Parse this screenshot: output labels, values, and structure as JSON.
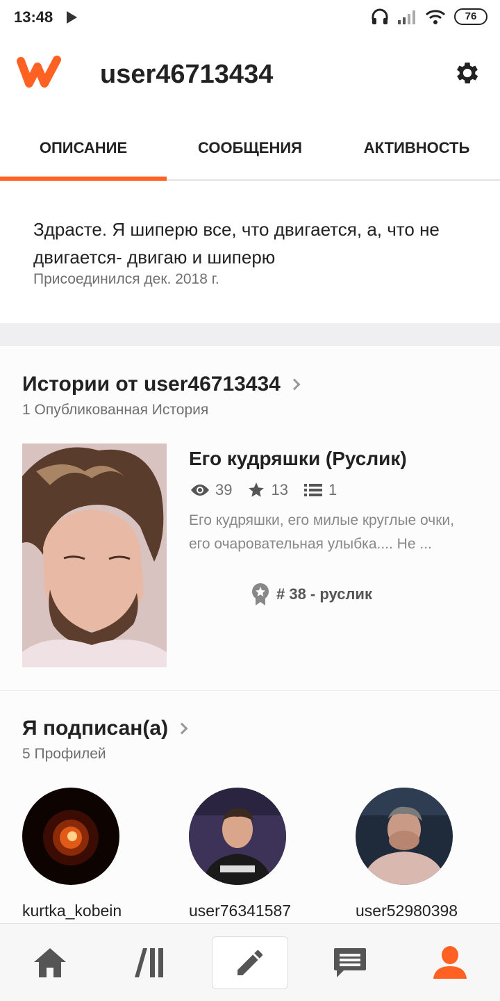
{
  "status_bar": {
    "time": "13:48",
    "battery": "76",
    "icons": [
      "play-icon",
      "headphones-icon",
      "signal-icon",
      "wifi-icon",
      "battery-icon"
    ]
  },
  "header": {
    "logo_icon": "wattpad-logo",
    "username": "user46713434",
    "settings_icon": "gear-icon"
  },
  "tabs": [
    {
      "label": "ОПИСАНИЕ",
      "active": true
    },
    {
      "label": "СООБЩЕНИЯ",
      "active": false
    },
    {
      "label": "АКТИВНОСТЬ",
      "active": false
    }
  ],
  "description": {
    "text": "Здрасте. Я шиперю все, что двигается, а, что не двигается- двигаю и шиперю",
    "joined": "Присоединился дек. 2018 г."
  },
  "stories": {
    "title": "Истории от user46713434",
    "subtitle": "1 Опубликованная История",
    "items": [
      {
        "title": "Его кудряшки (Руслик)",
        "reads": "39",
        "votes": "13",
        "parts": "1",
        "blurb": "Его кудряшки, его милые круглые очки, его очаровательная улыбка.... Не ...",
        "rank": "# 38 - руслик"
      }
    ]
  },
  "following": {
    "title": "Я подписан(а)",
    "subtitle": "5 Профилей",
    "profiles": [
      {
        "name": "kurtka_kobein"
      },
      {
        "name": "user76341587"
      },
      {
        "name": "user52980398"
      }
    ]
  },
  "bottom_nav": {
    "items": [
      "home-icon",
      "library-icon",
      "write-icon",
      "messages-icon",
      "profile-icon"
    ],
    "active_color": "#ff6122",
    "inactive_color": "#555555"
  },
  "colors": {
    "accent": "#ff6122"
  }
}
